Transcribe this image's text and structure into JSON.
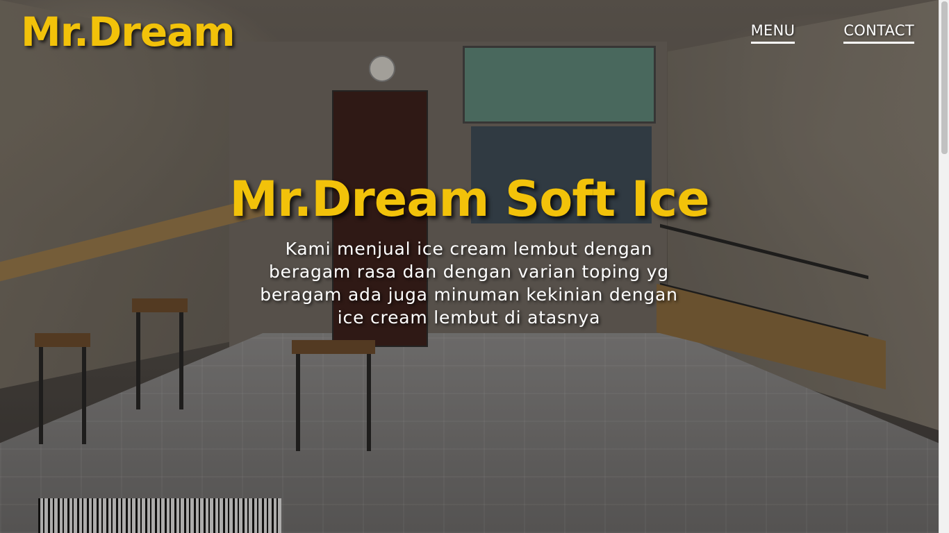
{
  "header": {
    "logo": "Mr.Dream",
    "nav": [
      {
        "label": "MENU"
      },
      {
        "label": "CONTACT"
      }
    ]
  },
  "hero": {
    "title": "Mr.Dream Soft Ice",
    "description": "Kami menjual ice cream lembut dengan beragam rasa dan dengan varian toping yg beragam ada juga minuman kekinian dengan ice cream lembut di atasnya"
  },
  "colors": {
    "accent": "#f2c20a",
    "text": "#ffffff"
  }
}
